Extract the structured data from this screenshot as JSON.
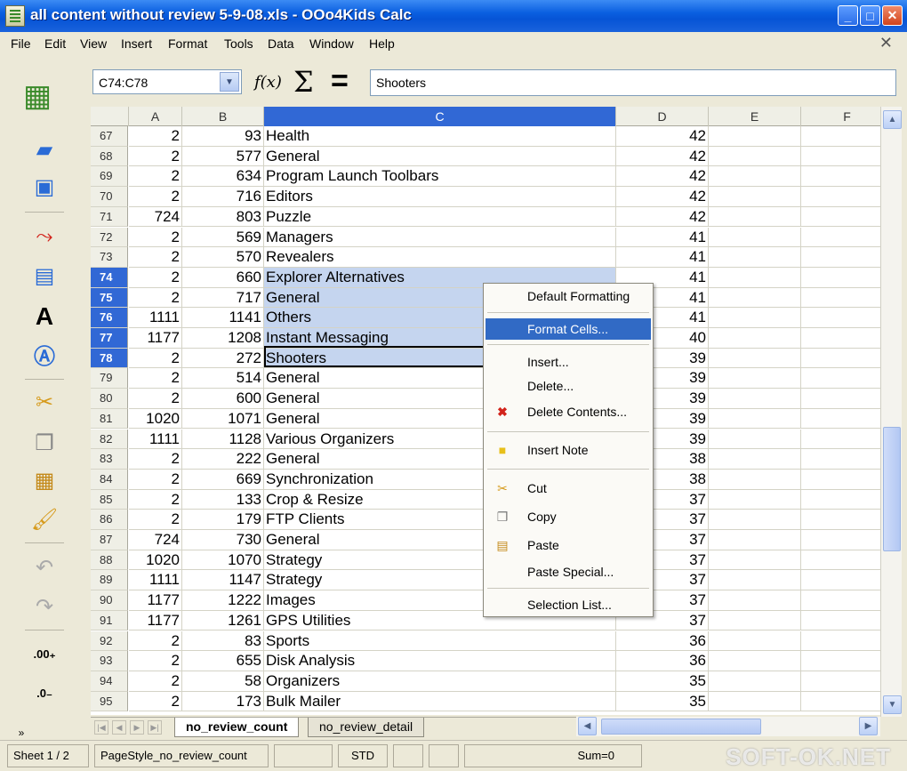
{
  "window": {
    "title": "all content without review 5-9-08.xls - OOo4Kids Calc"
  },
  "menubar": [
    "File",
    "Edit",
    "View",
    "Insert",
    "Format",
    "Tools",
    "Data",
    "Window",
    "Help"
  ],
  "formula_bar": {
    "name_box": "C74:C78",
    "content": "Shooters"
  },
  "columns": [
    "A",
    "B",
    "C",
    "D",
    "E",
    "F"
  ],
  "rows": [
    {
      "n": "67",
      "a": "2",
      "b": "93",
      "c": "Health",
      "d": "42"
    },
    {
      "n": "68",
      "a": "2",
      "b": "577",
      "c": "General",
      "d": "42"
    },
    {
      "n": "69",
      "a": "2",
      "b": "634",
      "c": "Program Launch Toolbars",
      "d": "42"
    },
    {
      "n": "70",
      "a": "2",
      "b": "716",
      "c": "Editors",
      "d": "42"
    },
    {
      "n": "71",
      "a": "724",
      "b": "803",
      "c": "Puzzle",
      "d": "42"
    },
    {
      "n": "72",
      "a": "2",
      "b": "569",
      "c": "Managers",
      "d": "41"
    },
    {
      "n": "73",
      "a": "2",
      "b": "570",
      "c": "Revealers",
      "d": "41"
    },
    {
      "n": "74",
      "a": "2",
      "b": "660",
      "c": "Explorer Alternatives",
      "d": "41"
    },
    {
      "n": "75",
      "a": "2",
      "b": "717",
      "c": "General",
      "d": "41"
    },
    {
      "n": "76",
      "a": "1111",
      "b": "1141",
      "c": "Others",
      "d": "41"
    },
    {
      "n": "77",
      "a": "1177",
      "b": "1208",
      "c": "Instant Messaging",
      "d": "40"
    },
    {
      "n": "78",
      "a": "2",
      "b": "272",
      "c": "Shooters",
      "d": "39"
    },
    {
      "n": "79",
      "a": "2",
      "b": "514",
      "c": "General",
      "d": "39"
    },
    {
      "n": "80",
      "a": "2",
      "b": "600",
      "c": "General",
      "d": "39"
    },
    {
      "n": "81",
      "a": "1020",
      "b": "1071",
      "c": "General",
      "d": "39"
    },
    {
      "n": "82",
      "a": "1111",
      "b": "1128",
      "c": "Various Organizers",
      "d": "39"
    },
    {
      "n": "83",
      "a": "2",
      "b": "222",
      "c": "General",
      "d": "38"
    },
    {
      "n": "84",
      "a": "2",
      "b": "669",
      "c": "Synchronization",
      "d": "38"
    },
    {
      "n": "85",
      "a": "2",
      "b": "133",
      "c": "Crop & Resize",
      "d": "37"
    },
    {
      "n": "86",
      "a": "2",
      "b": "179",
      "c": "FTP Clients",
      "d": "37"
    },
    {
      "n": "87",
      "a": "724",
      "b": "730",
      "c": "General",
      "d": "37"
    },
    {
      "n": "88",
      "a": "1020",
      "b": "1070",
      "c": "Strategy",
      "d": "37"
    },
    {
      "n": "89",
      "a": "1111",
      "b": "1147",
      "c": "Strategy",
      "d": "37"
    },
    {
      "n": "90",
      "a": "1177",
      "b": "1222",
      "c": "Images",
      "d": "37"
    },
    {
      "n": "91",
      "a": "1177",
      "b": "1261",
      "c": "GPS Utilities",
      "d": "37"
    },
    {
      "n": "92",
      "a": "2",
      "b": "83",
      "c": "Sports",
      "d": "36"
    },
    {
      "n": "93",
      "a": "2",
      "b": "655",
      "c": "Disk Analysis",
      "d": "36"
    },
    {
      "n": "94",
      "a": "2",
      "b": "58",
      "c": "Organizers",
      "d": "35"
    },
    {
      "n": "95",
      "a": "2",
      "b": "173",
      "c": "Bulk Mailer",
      "d": "35"
    }
  ],
  "selected_rows": [
    "74",
    "75",
    "76",
    "77",
    "78"
  ],
  "context_menu": {
    "default_formatting": "Default Formatting",
    "format_cells": "Format Cells...",
    "insert": "Insert...",
    "delete": "Delete...",
    "delete_contents": "Delete Contents...",
    "insert_note": "Insert Note",
    "cut": "Cut",
    "copy": "Copy",
    "paste": "Paste",
    "paste_special": "Paste Special...",
    "selection_list": "Selection List..."
  },
  "sheet_tabs": [
    "no_review_count",
    "no_review_detail"
  ],
  "status_bar": {
    "sheet": "Sheet 1 / 2",
    "page_style": "PageStyle_no_review_count",
    "mode": "STD",
    "sum": "Sum=0",
    "watermark": "SOFT-OK.NET"
  }
}
